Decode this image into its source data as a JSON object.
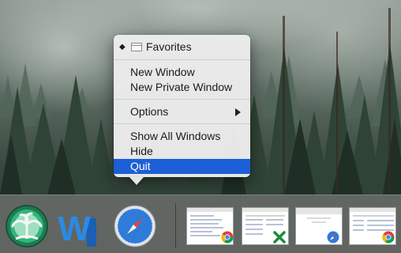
{
  "menu": {
    "items": [
      {
        "label": "Favorites",
        "checked": true,
        "icon": "window-icon"
      },
      {
        "label": "New Window"
      },
      {
        "label": "New Private Window"
      },
      {
        "label": "Options",
        "submenu": true
      },
      {
        "label": "Show All Windows"
      },
      {
        "label": "Hide"
      },
      {
        "label": "Quit",
        "selected": true
      }
    ],
    "checkmark": "◆"
  },
  "dock": {
    "apps": [
      {
        "name": "palm-tree-app-icon"
      },
      {
        "name": "word-app-icon"
      },
      {
        "name": "safari-app-icon"
      }
    ],
    "windows": [
      {
        "name": "chrome-window-thumbnail",
        "badge": "chrome-icon"
      },
      {
        "name": "excel-window-thumbnail",
        "badge": "excel-icon"
      },
      {
        "name": "safari-window-thumbnail",
        "badge": "safari-icon"
      },
      {
        "name": "chrome-window-thumbnail-2",
        "badge": "chrome-icon"
      }
    ]
  },
  "colors": {
    "selection": "#1c5fd6",
    "menu_bg": "#ececec",
    "dock_bg": "#696c6a"
  }
}
